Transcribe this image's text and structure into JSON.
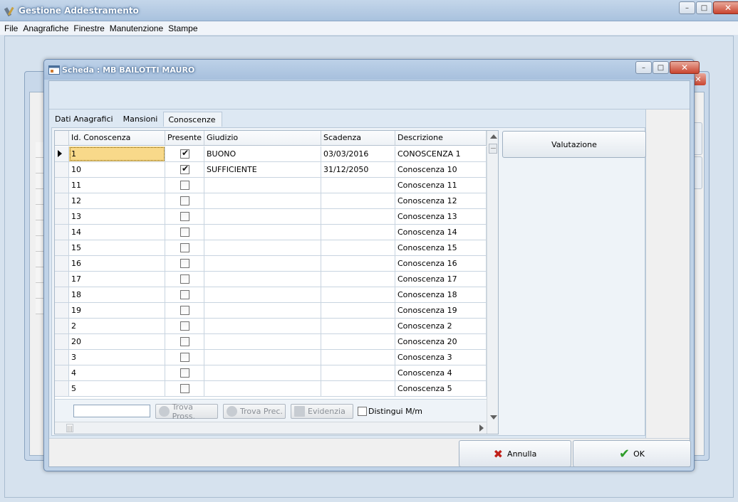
{
  "app": {
    "title": "Gestione Addestramento"
  },
  "menu": [
    "File",
    "Anagrafiche",
    "Finestre",
    "Manutenzione",
    "Stampe"
  ],
  "window_controls": {
    "minimize": "–",
    "maximize": "□",
    "close": "✕"
  },
  "dialog": {
    "title": "Scheda : MB BAILOTTI MAURO",
    "tabs": [
      {
        "label": "Dati Anagrafici",
        "active": false
      },
      {
        "label": "Mansioni",
        "active": false
      },
      {
        "label": "Conoscenze",
        "active": true
      }
    ]
  },
  "grid": {
    "columns": [
      "Id. Conoscenza",
      "Presente",
      "Giudizio",
      "Scadenza",
      "Descrizione"
    ],
    "rows": [
      {
        "id": "1",
        "presente": true,
        "giudizio": "BUONO",
        "scadenza": "03/03/2016",
        "descrizione": "CONOSCENZA 1",
        "selected": true
      },
      {
        "id": "10",
        "presente": true,
        "giudizio": "SUFFICIENTE",
        "scadenza": "31/12/2050",
        "descrizione": "Conoscenza 10"
      },
      {
        "id": "11",
        "presente": false,
        "giudizio": "",
        "scadenza": "",
        "descrizione": "Conoscenza 11"
      },
      {
        "id": "12",
        "presente": false,
        "giudizio": "",
        "scadenza": "",
        "descrizione": "Conoscenza 12"
      },
      {
        "id": "13",
        "presente": false,
        "giudizio": "",
        "scadenza": "",
        "descrizione": "Conoscenza 13"
      },
      {
        "id": "14",
        "presente": false,
        "giudizio": "",
        "scadenza": "",
        "descrizione": "Conoscenza 14"
      },
      {
        "id": "15",
        "presente": false,
        "giudizio": "",
        "scadenza": "",
        "descrizione": "Conoscenza 15"
      },
      {
        "id": "16",
        "presente": false,
        "giudizio": "",
        "scadenza": "",
        "descrizione": "Conoscenza 16"
      },
      {
        "id": "17",
        "presente": false,
        "giudizio": "",
        "scadenza": "",
        "descrizione": "Conoscenza 17"
      },
      {
        "id": "18",
        "presente": false,
        "giudizio": "",
        "scadenza": "",
        "descrizione": "Conoscenza 18"
      },
      {
        "id": "19",
        "presente": false,
        "giudizio": "",
        "scadenza": "",
        "descrizione": "Conoscenza 19"
      },
      {
        "id": "2",
        "presente": false,
        "giudizio": "",
        "scadenza": "",
        "descrizione": "Conoscenza 2"
      },
      {
        "id": "20",
        "presente": false,
        "giudizio": "",
        "scadenza": "",
        "descrizione": "Conoscenza 20"
      },
      {
        "id": "3",
        "presente": false,
        "giudizio": "",
        "scadenza": "",
        "descrizione": "Conoscenza 3"
      },
      {
        "id": "4",
        "presente": false,
        "giudizio": "",
        "scadenza": "",
        "descrizione": "Conoscenza 4"
      },
      {
        "id": "5",
        "presente": false,
        "giudizio": "",
        "scadenza": "",
        "descrizione": "Conoscenza 5"
      }
    ],
    "footer": {
      "search_value": "",
      "trova_pross": "Trova Pross.",
      "trova_prec": "Trova Prec.",
      "evidenzia": "Evidenzia",
      "distingui": "Distingui M/m"
    }
  },
  "buttons": {
    "valutazione": "Valutazione",
    "annulla": "Annulla",
    "ok": "OK"
  },
  "colors": {
    "accent": "#a9c2de",
    "selected_cell": "#f8d98a",
    "cancel_icon": "#c0201a",
    "ok_icon": "#2e9c2a"
  }
}
